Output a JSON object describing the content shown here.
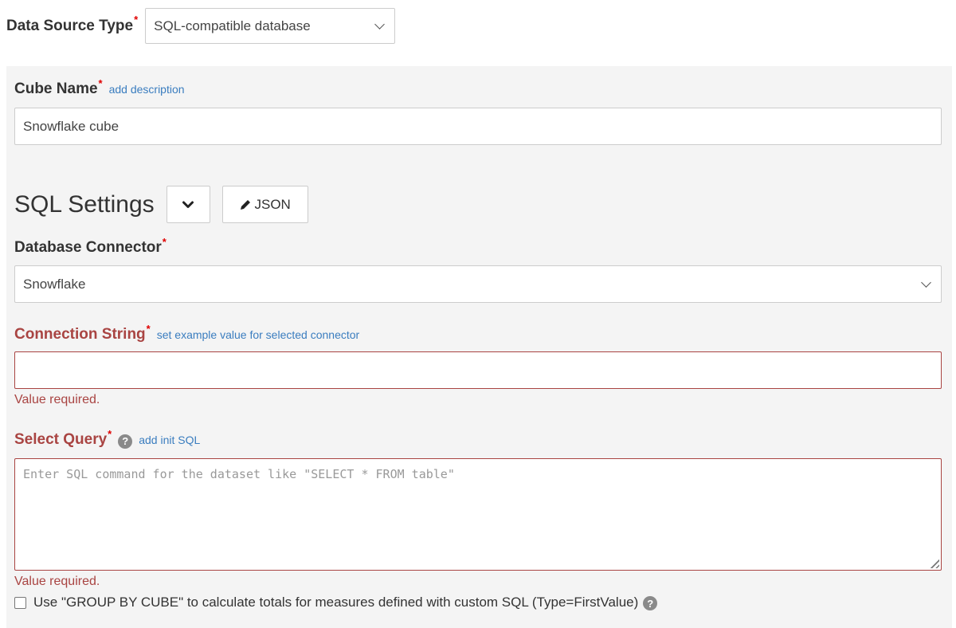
{
  "data_source": {
    "label": "Data Source Type",
    "required_mark": "*",
    "selected": "SQL-compatible database"
  },
  "cube_name": {
    "label": "Cube Name",
    "required_mark": "*",
    "link": "add description",
    "value": "Snowflake cube"
  },
  "sql_settings": {
    "title": "SQL Settings",
    "json_button": "JSON"
  },
  "database_connector": {
    "label": "Database Connector",
    "required_mark": "*",
    "selected": "Snowflake"
  },
  "connection_string": {
    "label": "Connection String",
    "required_mark": "*",
    "link": "set example value for selected connector",
    "value": "",
    "error": "Value required."
  },
  "select_query": {
    "label": "Select Query",
    "required_mark": "*",
    "help_icon": "?",
    "link": "add init SQL",
    "placeholder": "Enter SQL command for the dataset like \"SELECT * FROM table\"",
    "value": "",
    "error": "Value required."
  },
  "group_by_cube": {
    "label": "Use \"GROUP BY CUBE\" to calculate totals for measures defined with custom SQL (Type=FirstValue)",
    "checked": false,
    "help_icon": "?"
  },
  "colors": {
    "error": "#a94442",
    "link": "#3a7dbf",
    "required": "#e00000",
    "panel_bg": "#f4f4f4"
  }
}
